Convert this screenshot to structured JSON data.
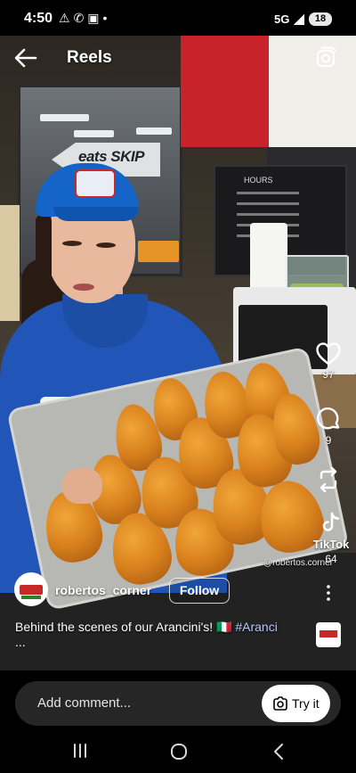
{
  "status_bar": {
    "time": "4:50",
    "notification_icons": [
      "warning-icon",
      "whatsapp-icon",
      "screenshot-icon",
      "dot-icon"
    ],
    "network": "5G",
    "battery": "18"
  },
  "header": {
    "title": "Reels"
  },
  "actions": {
    "likes": "97",
    "comments": "9",
    "shares": "64"
  },
  "watermark": {
    "name": "TikTok",
    "handle": "@robertos.corner"
  },
  "post": {
    "username": "robertos_corner",
    "follow_label": "Follow",
    "caption": "Behind the scenes of our Arancini's! 🇮🇹 ",
    "hashtag": "#Aranci",
    "caption_more": "..."
  },
  "comment_bar": {
    "placeholder": "Add comment...",
    "try_label": "Try it"
  },
  "background_text": {
    "sign": "eats SKIP",
    "hours": "HOURS"
  },
  "colors": {
    "accent_blue": "#2156b8",
    "hashtag": "#b9c7ff"
  }
}
